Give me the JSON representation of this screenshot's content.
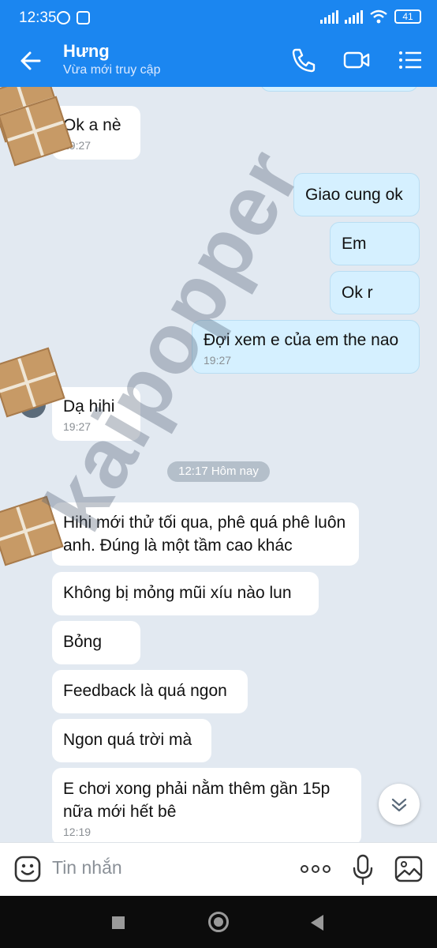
{
  "status_bar": {
    "time": "12:35",
    "battery": "41"
  },
  "header": {
    "name": "Hưng",
    "status": "Vừa mới truy cập"
  },
  "messages": [
    {
      "text": "Ok a nè",
      "time": "19:27"
    },
    {
      "text": "Giao cung ok"
    },
    {
      "text": "Em"
    },
    {
      "text": "Ok r"
    },
    {
      "text": "Đợi xem e của em the nao",
      "time": "19:27"
    },
    {
      "text": "Dạ hihi",
      "time": "19:27"
    },
    {
      "text": "Hihi mới thử tối qua, phê quá phê luôn anh. Đúng là một tầm cao khác"
    },
    {
      "text": "Không bị mỏng mũi xíu nào lun"
    },
    {
      "text": "Bỏng"
    },
    {
      "text": "Feedback là quá ngon"
    },
    {
      "text": "Ngon quá trời mà"
    },
    {
      "text": "E chơi xong phải nằm thêm gần 15p nữa mới hết bê",
      "time": "12:19"
    }
  ],
  "date_separator": "12:17 Hôm nay",
  "watermark": "kaipopper",
  "input": {
    "placeholder": "Tin nhắn"
  },
  "icons": {
    "back": "arrow-left-icon",
    "call": "phone-icon",
    "video": "video-camera-icon",
    "menu": "list-menu-icon",
    "emoji": "emoji-icon",
    "more": "more-dots-icon",
    "mic": "microphone-icon",
    "image": "image-icon",
    "scroll": "chevron-double-down-icon"
  },
  "colors": {
    "header": "#1b86f0",
    "chat_bg": "#e2e9f1",
    "outgoing_bubble": "#d5f0ff",
    "incoming_bubble": "#ffffff"
  }
}
